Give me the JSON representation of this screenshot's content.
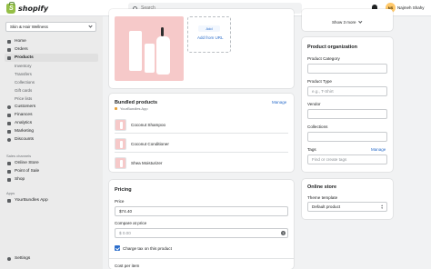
{
  "topbar": {
    "logo_text": "shopify",
    "search_placeholder": "Search",
    "user_initials": "NS",
    "user_name": "Najmeh Shahy"
  },
  "sidebar": {
    "store_name": "Skin & Hair Wellness",
    "items": [
      {
        "label": "Home"
      },
      {
        "label": "Orders"
      },
      {
        "label": "Products"
      }
    ],
    "product_sub_items": [
      "Inventory",
      "Transfers",
      "Collections",
      "Gift cards",
      "Price lists"
    ],
    "items2": [
      {
        "label": "Customers"
      },
      {
        "label": "Finances"
      },
      {
        "label": "Analytics"
      },
      {
        "label": "Marketing"
      },
      {
        "label": "Discounts"
      }
    ],
    "sales_channels_label": "Sales channels",
    "sales_channels": [
      {
        "label": "Online Store"
      },
      {
        "label": "Point of Sale"
      },
      {
        "label": "Shop"
      }
    ],
    "apps_label": "Apps",
    "apps": [
      {
        "label": "YourBundles App"
      }
    ],
    "settings_label": "Settings"
  },
  "media": {
    "add_label": "Add",
    "add_from_url": "Add from URL"
  },
  "bundled_products": {
    "title": "Bundled products",
    "manage_label": "Manage",
    "app_name": "YourBundles App",
    "items": [
      "Coconut Shampoo",
      "Coconut Conditioner",
      "Shea Moisturizer"
    ]
  },
  "pricing": {
    "title": "Pricing",
    "price_label": "Price",
    "price_value": "$74.40",
    "compare_label": "Compare at price",
    "compare_value": "$ 0.00",
    "charge_tax_label": "Charge tax on this product",
    "cost_label": "Cost per item"
  },
  "right_top": {
    "show_more": "Show 3 more"
  },
  "organization": {
    "title": "Product organization",
    "product_category_label": "Product Category",
    "product_type_label": "Product Type",
    "product_type_placeholder": "e.g., T-Shirt",
    "vendor_label": "Vendor",
    "collections_label": "Collections",
    "tags_label": "Tags",
    "tags_manage": "Manage",
    "tags_placeholder": "Find or create tags"
  },
  "online_store": {
    "title": "Online store",
    "theme_template_label": "Theme template",
    "theme_template_value": "Default product"
  },
  "colors": {
    "accent": "#2c6ecb",
    "brand": "#95bf47",
    "product_bg": "#f6c9c9"
  }
}
